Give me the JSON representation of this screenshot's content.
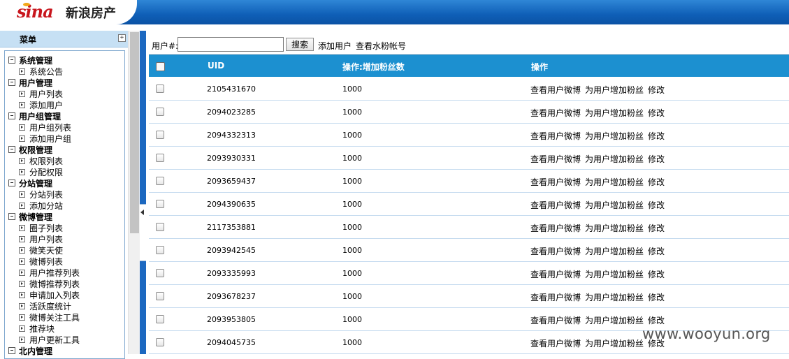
{
  "header": {
    "logo_text": "sina",
    "site_title": "新浪房产",
    "brand_color": "#c8161d"
  },
  "menu": {
    "title": "菜单",
    "expand_icon": "plus-box-icon",
    "tree": [
      {
        "group": "系统管理",
        "items": [
          "系统公告"
        ]
      },
      {
        "group": "用户管理",
        "items": [
          "用户列表",
          "添加用户"
        ]
      },
      {
        "group": "用户组管理",
        "items": [
          "用户组列表",
          "添加用户组"
        ]
      },
      {
        "group": "权限管理",
        "items": [
          "权限列表",
          "分配权限"
        ]
      },
      {
        "group": "分站管理",
        "items": [
          "分站列表",
          "添加分站"
        ]
      },
      {
        "group": "微博管理",
        "items": [
          "圈子列表",
          "用户列表",
          "微笑天使",
          "微博列表",
          "用户推荐列表",
          "微博推荐列表",
          "申请加入列表",
          "活跃度统计",
          "微博关注工具",
          "推荐块",
          "用户更新工具"
        ]
      },
      {
        "group": "北内管理",
        "items": []
      }
    ]
  },
  "toolbar": {
    "uid_label": "用户#:",
    "uid_value": "",
    "search_label": "搜索",
    "add_user_label": "添加用户",
    "view_water_label": "查看水粉帐号"
  },
  "table": {
    "accent": "#1c90d0",
    "columns": [
      "UID",
      "操作:增加粉丝数",
      "操作"
    ],
    "op_labels": [
      "查看用户微博",
      "为用户增加粉丝",
      "修改"
    ],
    "rows": [
      {
        "uid": "2105431670",
        "fans": "1000"
      },
      {
        "uid": "2094023285",
        "fans": "1000"
      },
      {
        "uid": "2094332313",
        "fans": "1000"
      },
      {
        "uid": "2093930331",
        "fans": "1000"
      },
      {
        "uid": "2093659437",
        "fans": "1000"
      },
      {
        "uid": "2094390635",
        "fans": "1000"
      },
      {
        "uid": "2117353881",
        "fans": "1000"
      },
      {
        "uid": "2093942545",
        "fans": "1000"
      },
      {
        "uid": "2093335993",
        "fans": "1000"
      },
      {
        "uid": "2093678237",
        "fans": "1000"
      },
      {
        "uid": "2093953805",
        "fans": "1000"
      },
      {
        "uid": "2094045735",
        "fans": "1000"
      }
    ]
  },
  "watermark": "www.wooyun.org"
}
